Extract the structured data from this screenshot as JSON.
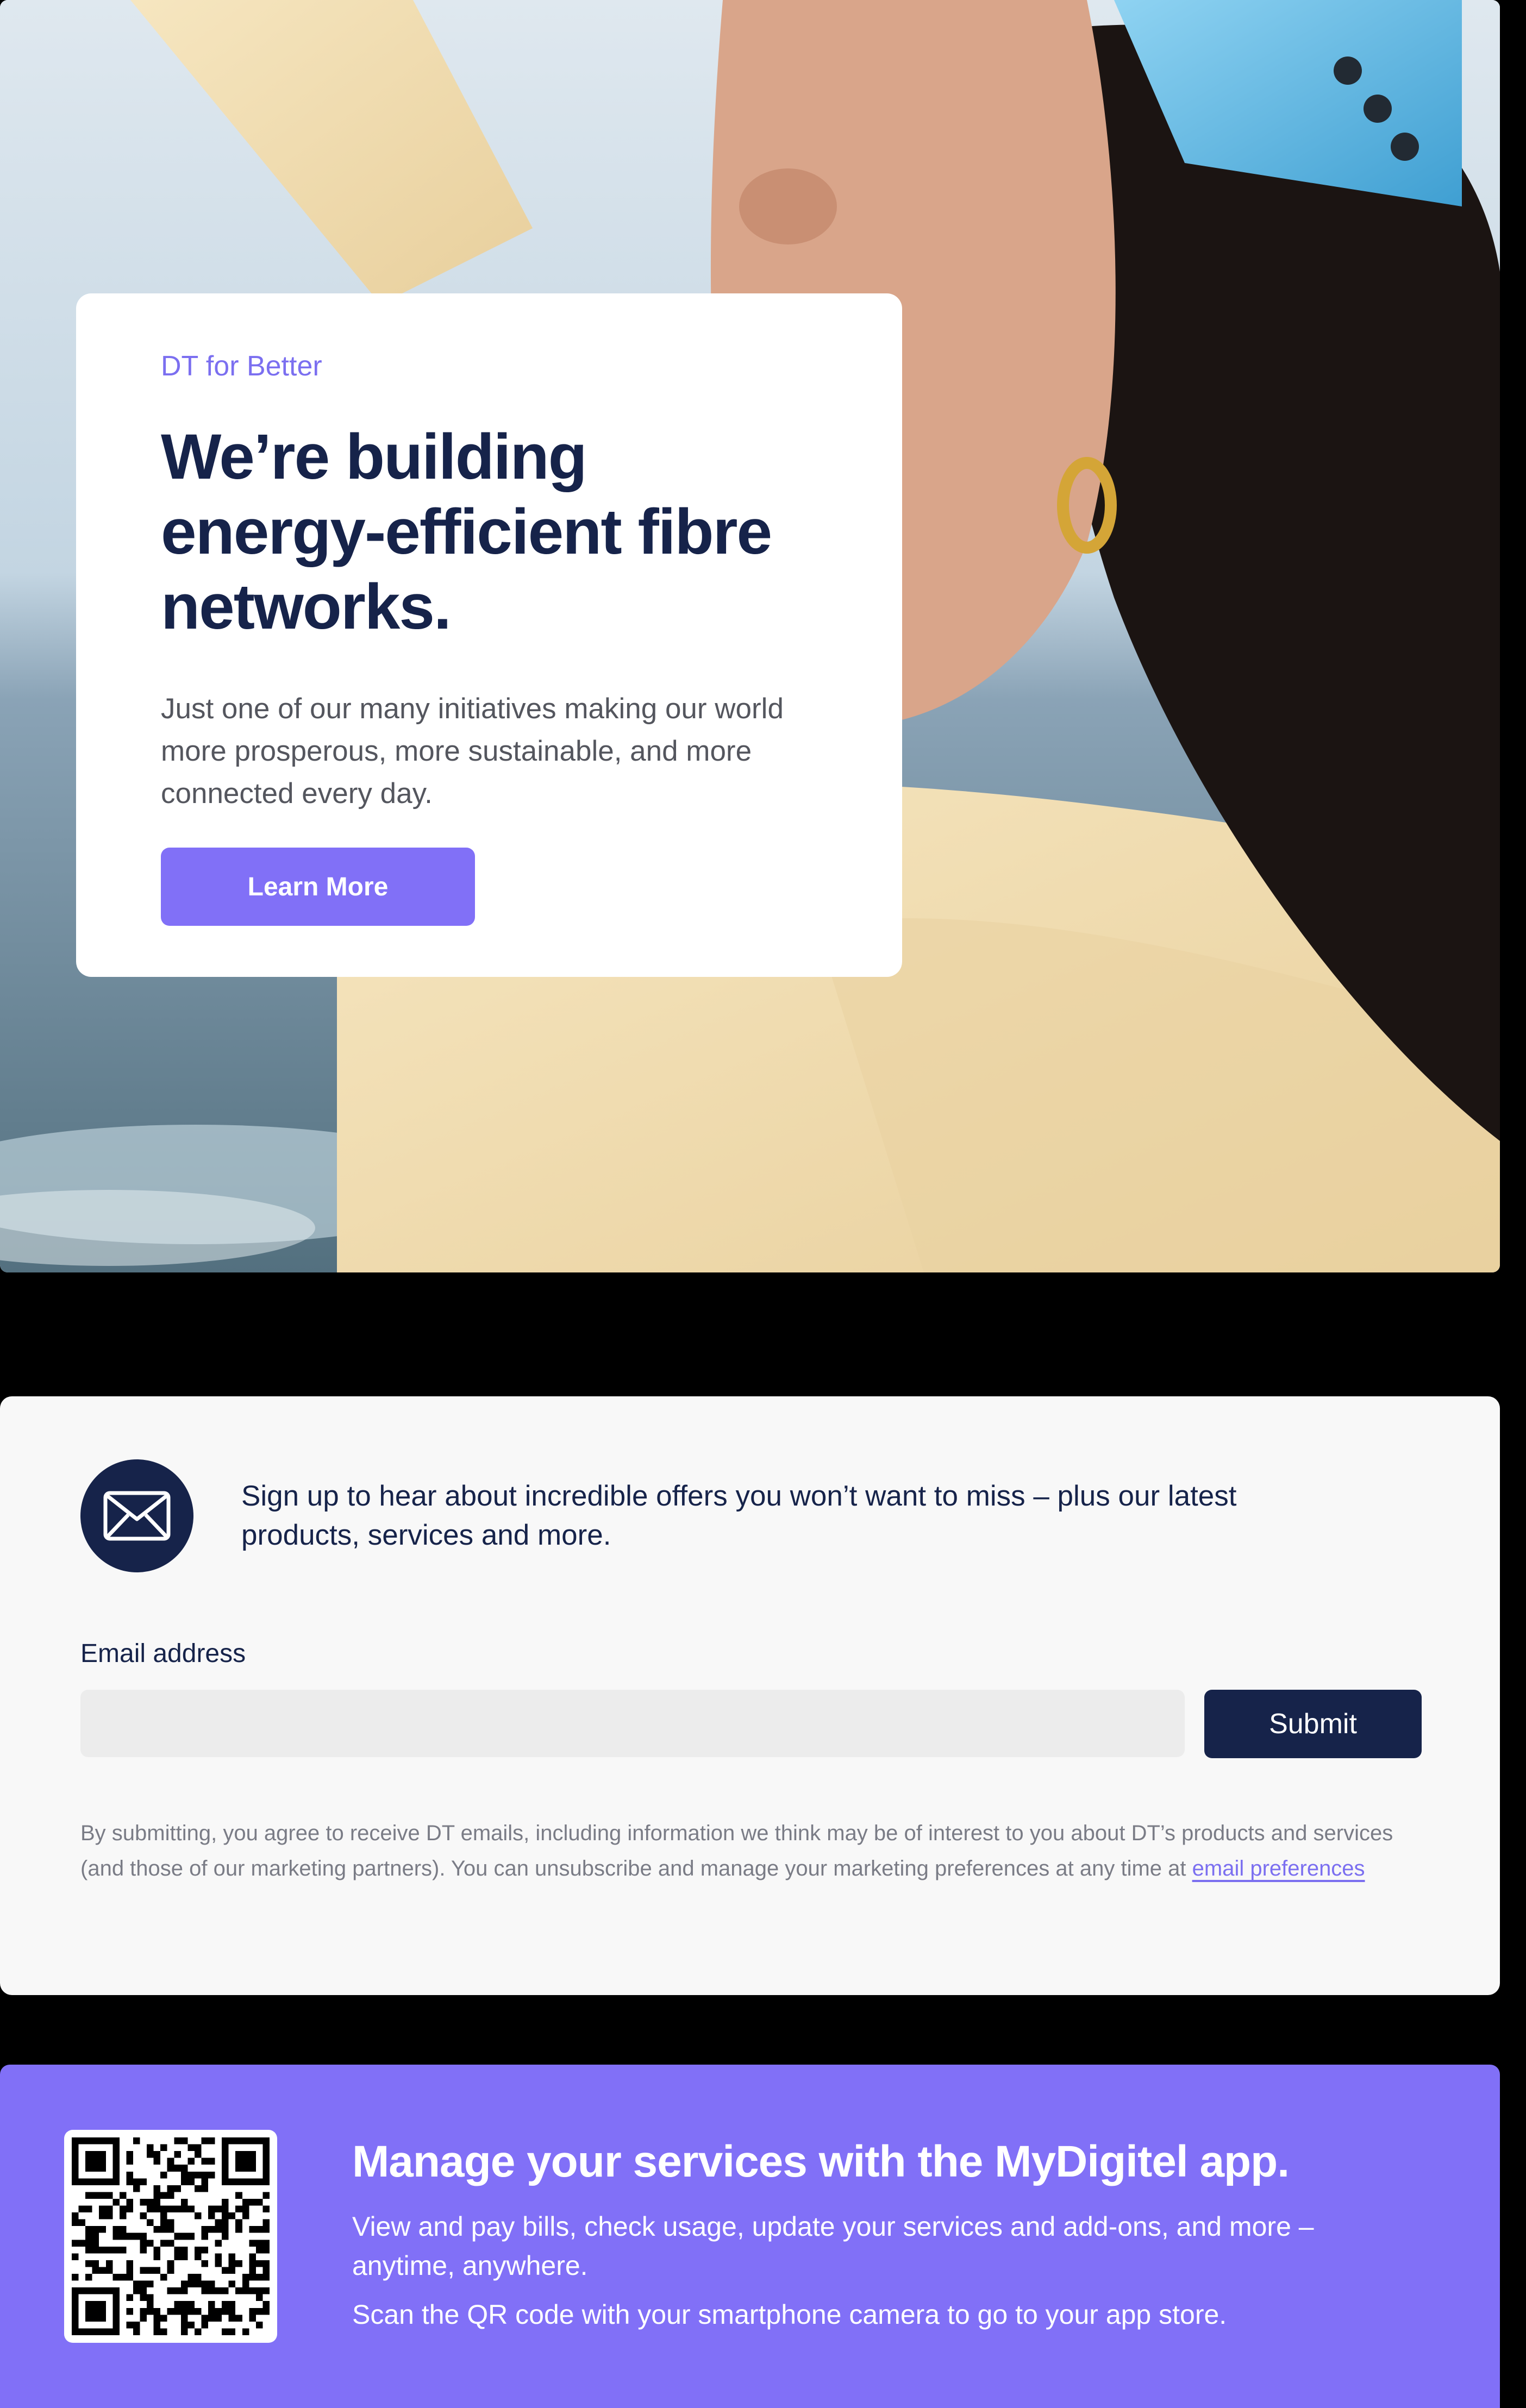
{
  "hero": {
    "eyebrow": "DT for Better",
    "title_line1": "We’re building",
    "title_line2": "energy-efficient fibre",
    "title_line3": "networks.",
    "body": "Just one of our many initiatives making our world more prosperous, more sustainable, and more connected every day.",
    "cta_label": "Learn More"
  },
  "newsletter": {
    "icon": "envelope-icon",
    "signup_text": "Sign up to hear about incredible offers you won’t want to miss – plus our latest products, services and more.",
    "email_label": "Email address",
    "email_value": "",
    "email_placeholder": "",
    "submit_label": "Submit",
    "legal_text": "By submitting, you agree to receive DT emails, including information we think may be of interest to you about DT’s products and services (and those of our marketing partners). You can unsubscribe and manage your marketing preferences at any time at",
    "legal_link": "email preferences"
  },
  "app_banner": {
    "title": "Manage your services with the MyDigitel app.",
    "body": "View and pay bills, check usage, update your services and add-ons, and more – anytime, anywhere.",
    "scan_text": "Scan the QR code with your smartphone camera to go to your app store.",
    "qr_icon": "qr-code-icon"
  },
  "colors": {
    "navy": "#16234a",
    "purple": "#8170f7",
    "eyebrow_purple": "#7b6ff0",
    "panel_bg": "#f8f8f8"
  }
}
